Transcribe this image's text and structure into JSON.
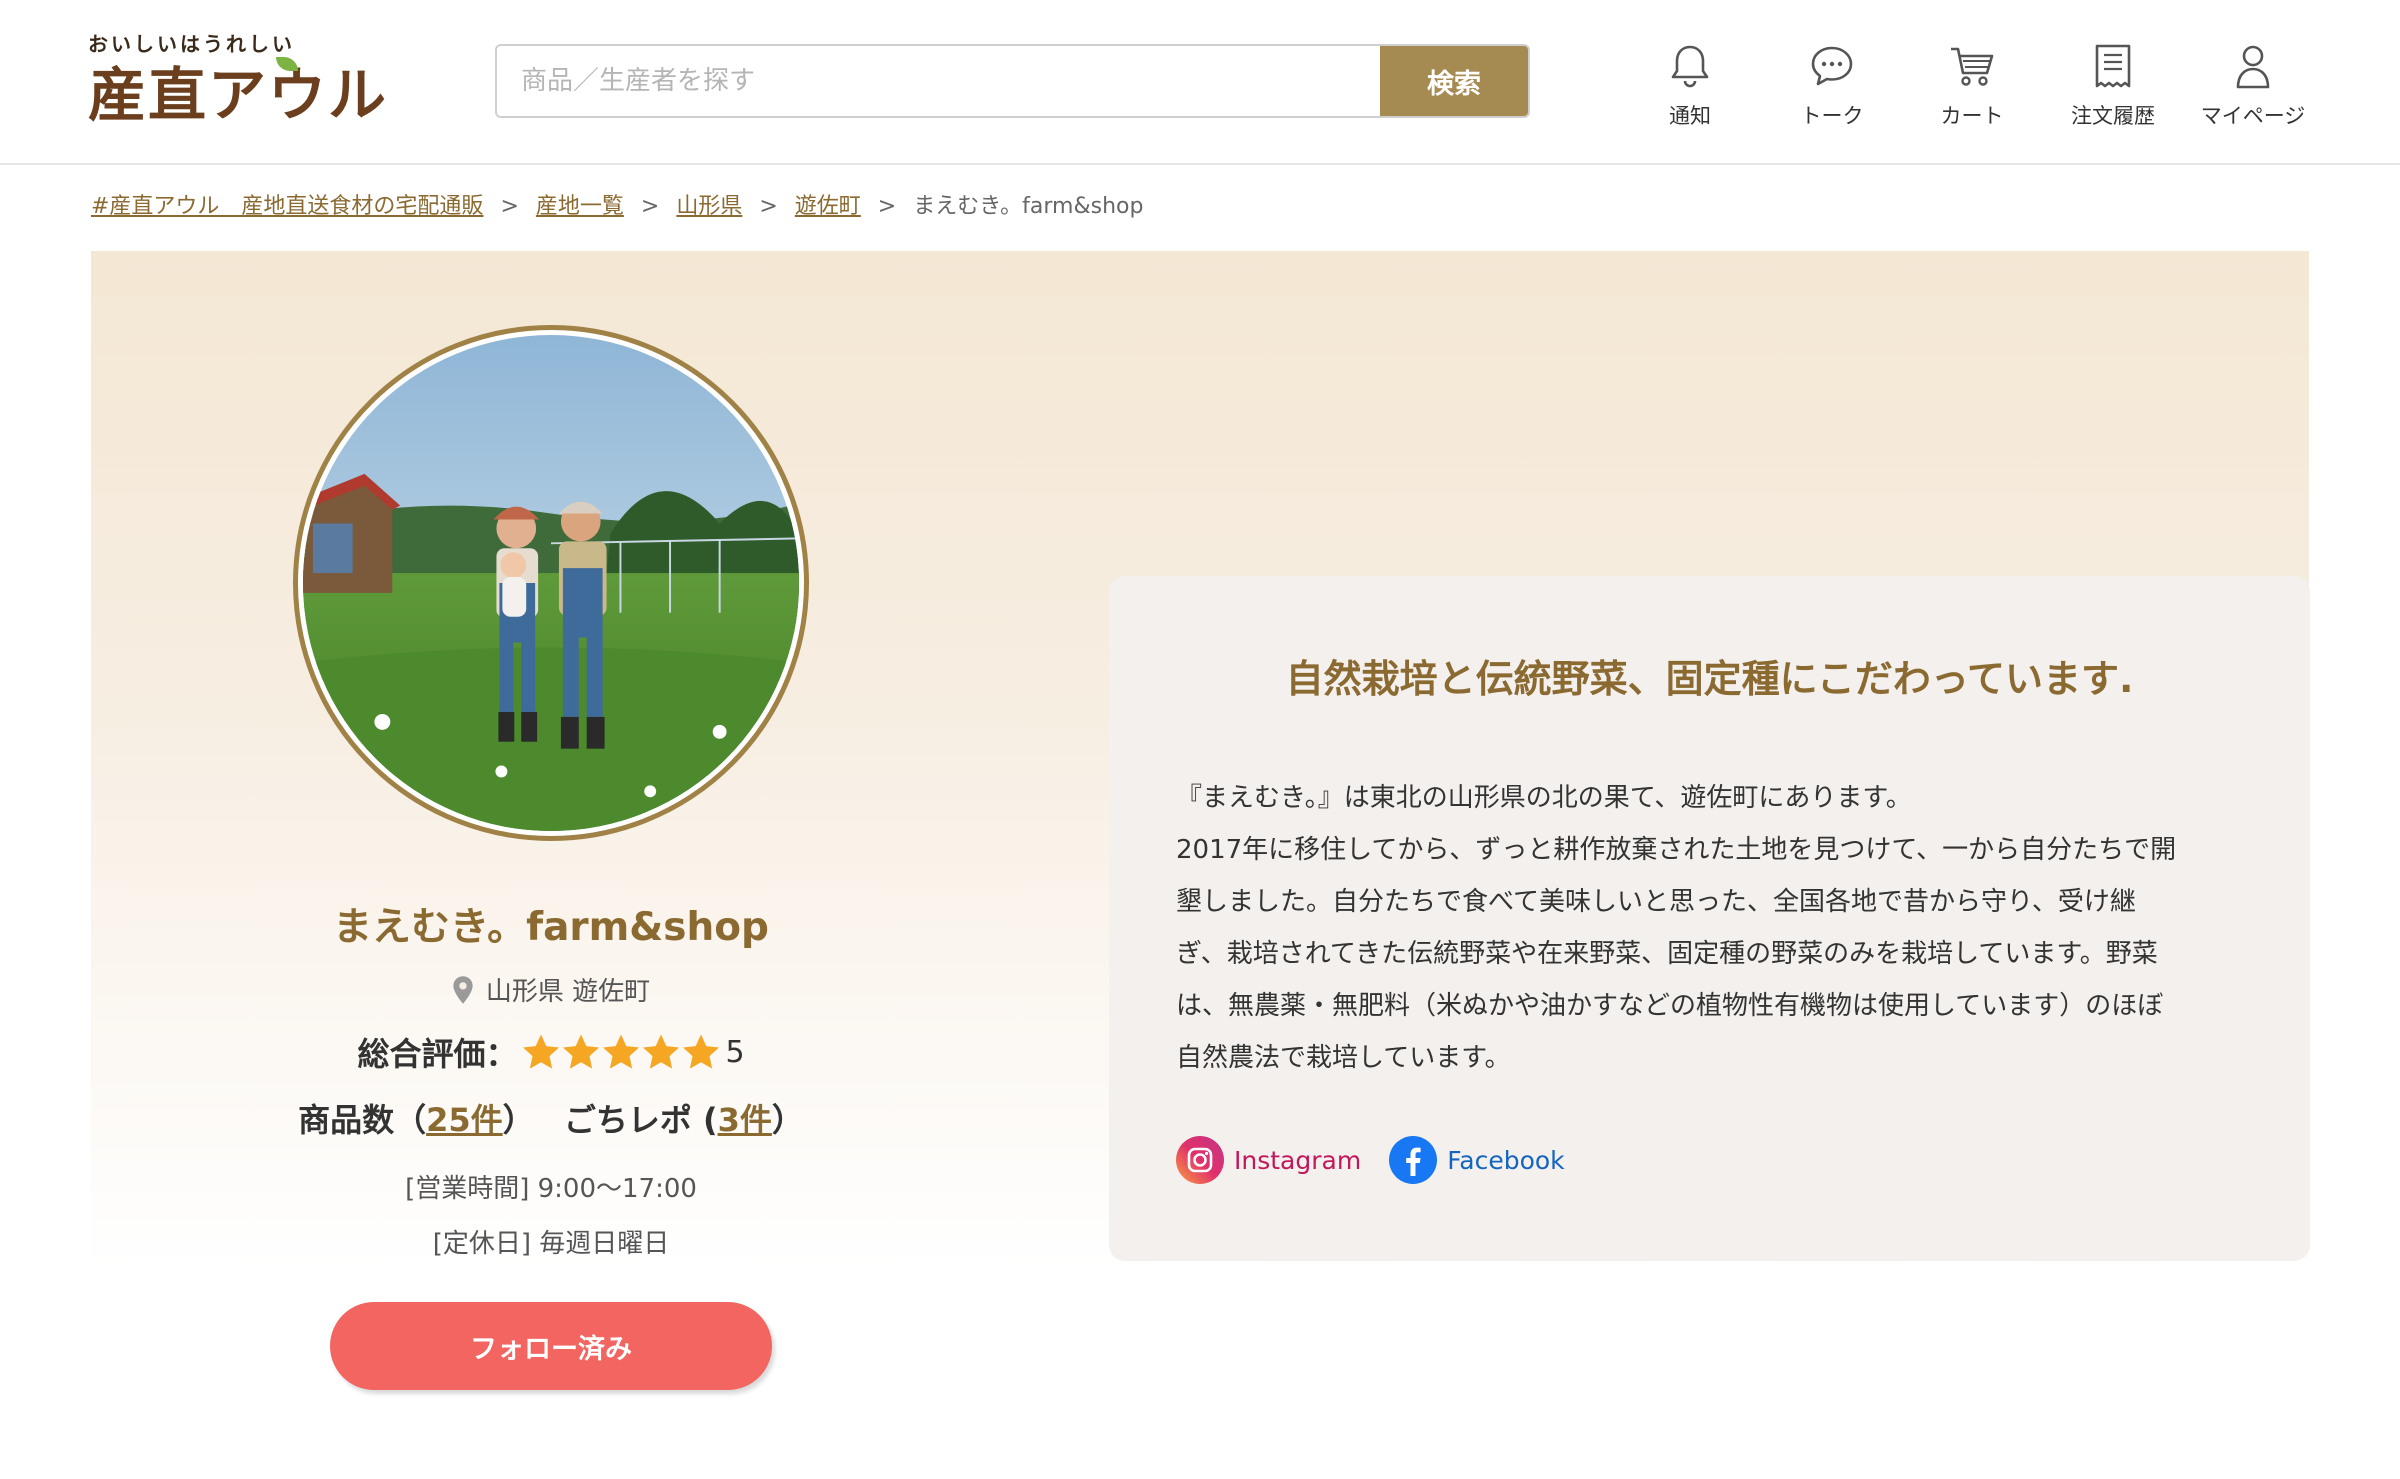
{
  "header": {
    "logo_tagline": "おいしいはうれしい",
    "logo_name": "産直アウル",
    "search_placeholder": "商品／生産者を探す",
    "search_button": "検索",
    "nav": {
      "notification": "通知",
      "talk": "トーク",
      "cart": "カート",
      "orders": "注文履歴",
      "mypage": "マイページ"
    }
  },
  "breadcrumb": {
    "items": [
      "#産直アウル　産地直送食材の宅配通販",
      "産地一覧",
      "山形県",
      "遊佐町"
    ],
    "current": "まえむき。farm&shop",
    "separator": ">"
  },
  "producer": {
    "name": "まえむき。farm&shop",
    "location": "山形県 遊佐町",
    "rating_label": "総合評価：",
    "rating_value": "5",
    "rating_stars": 5,
    "products_label": "商品数（",
    "products_count": "25件",
    "products_close": "）",
    "reports_label": "ごちレポ (",
    "reports_count": "3件",
    "reports_close": "）",
    "hours": "[営業時間] 9:00～17:00",
    "holiday": "[定休日] 毎週日曜日",
    "follow_button": "フォロー済み"
  },
  "intro": {
    "title": "自然栽培と伝統野菜、固定種にこだわっています.",
    "lines": [
      "『まえむき。』は東北の山形県の北の果て、遊佐町にあります。",
      "2017年に移住してから、ずっと耕作放棄された土地を見つけて、一から自分たちで開",
      "墾しました。自分たちで食べて美味しいと思った、全国各地で昔から守り、受け継",
      "ぎ、栽培されてきた伝統野菜や在来野菜、固定種の野菜のみを栽培しています。野菜",
      "は、無農薬・無肥料（米ぬかや油かすなどの植物性有機物は使用しています）のほぼ",
      "自然農法で栽培しています。"
    ],
    "sns": {
      "instagram": "Instagram",
      "facebook": "Facebook"
    }
  },
  "colors": {
    "brand": "#a58a52",
    "accent_text": "#8b6a32",
    "follow": "#f26560",
    "star": "#f5a623"
  }
}
